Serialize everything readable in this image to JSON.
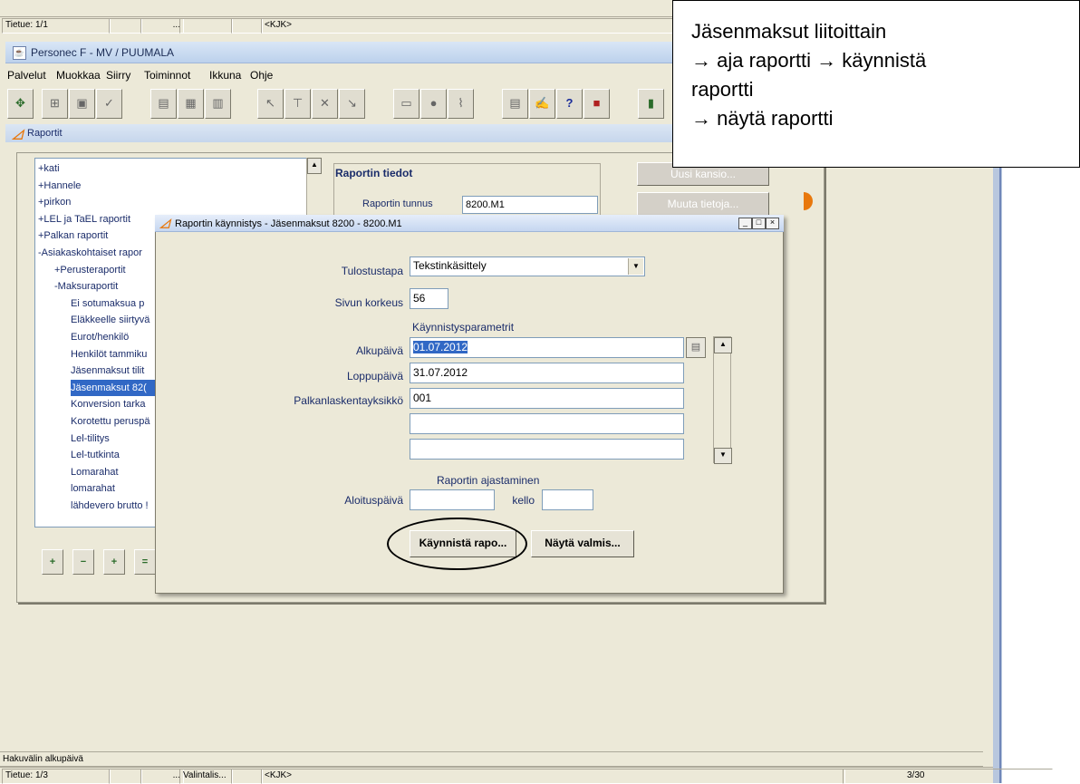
{
  "top_status": {
    "tietue": "Tietue: 1/1",
    "dots": "...",
    "kjk": "<KJK>"
  },
  "window": {
    "title": "Personec F - MV / PUUMALA"
  },
  "menu": [
    "Palvelut",
    "Muokkaa",
    "Siirry",
    "Toiminnot",
    "Ikkuna",
    "Ohje"
  ],
  "subwindow": {
    "title": "Raportit"
  },
  "tree": {
    "items": [
      {
        "label": "+kati",
        "indent": 0
      },
      {
        "label": "+Hannele",
        "indent": 0
      },
      {
        "label": "+pirkon",
        "indent": 0
      },
      {
        "label": "+LEL ja TaEL raportit",
        "indent": 0
      },
      {
        "label": "+Palkan raportit",
        "indent": 0
      },
      {
        "label": "-Asiakaskohtaiset rapor",
        "indent": 0
      },
      {
        "label": "+Perusteraportit",
        "indent": 1
      },
      {
        "label": "-Maksuraportit",
        "indent": 1
      },
      {
        "label": "Ei sotumaksua p",
        "indent": 2
      },
      {
        "label": "Eläkkeelle siirtyvä",
        "indent": 2
      },
      {
        "label": "Eurot/henkilö",
        "indent": 2
      },
      {
        "label": "Henkilöt tammiku",
        "indent": 2
      },
      {
        "label": "Jäsenmaksut tilit",
        "indent": 2
      },
      {
        "label": "Jäsenmaksut 82(",
        "indent": 2,
        "selected": true
      },
      {
        "label": "Konversion tarka",
        "indent": 2
      },
      {
        "label": "Korotettu peruspä",
        "indent": 2
      },
      {
        "label": "Lel-tilitys",
        "indent": 2
      },
      {
        "label": "Lel-tutkinta",
        "indent": 2
      },
      {
        "label": "Lomarahat",
        "indent": 2
      },
      {
        "label": "lomarahat",
        "indent": 2
      },
      {
        "label": "lähdevero brutto !",
        "indent": 2
      }
    ]
  },
  "info": {
    "title": "Raportin tiedot",
    "tunnus_label": "Raportin tunnus",
    "tunnus_value": "8200.M1"
  },
  "side_buttons": {
    "new_folder": "Uusi kansio...",
    "edit": "Muuta tietoja..."
  },
  "dialog": {
    "title": "Raportin käynnistys - Jäsenmaksut 8200 - 8200.M1",
    "tulostustapa_label": "Tulostustapa",
    "tulostustapa_value": "Tekstinkäsittely",
    "sivun_korkeus_label": "Sivun korkeus",
    "sivun_korkeus_value": "56",
    "params_heading": "Käynnistysparametrit",
    "alkupaiva_label": "Alkupäivä",
    "alkupaiva_value": "01.07.2012",
    "loppupaiva_label": "Loppupäivä",
    "loppupaiva_value": "31.07.2012",
    "yksikko_label": "Palkanlaskentayksikkö",
    "yksikko_value": "001",
    "schedule_heading": "Raportin ajastaminen",
    "aloituspaiva_label": "Aloituspäivä",
    "kello_label": "kello",
    "start_button": "Käynnistä rapo...",
    "show_button": "Näytä valmis..."
  },
  "bottom_status": {
    "hint": "Hakuvälin alkupäivä",
    "tietue": "Tietue: 1/3",
    "dots": "...",
    "valintalis": "Valintalis...",
    "kjk": "<KJK>",
    "page": "3/30"
  },
  "callout": {
    "line1": "Jäsenmaksut liitoittain",
    "line2": "→ aja raportti → käynnistä",
    "line3": "raportti",
    "line4": "→ näytä raportti"
  }
}
